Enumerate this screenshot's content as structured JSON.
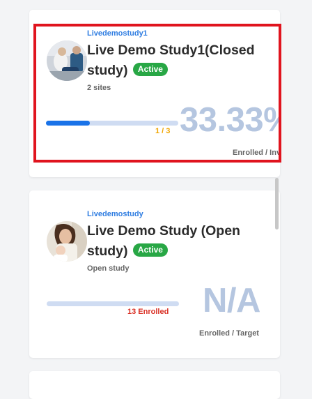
{
  "studies": [
    {
      "code": "Livedemostudy1",
      "title": "Live Demo Study1(Closed study)",
      "title_line1": "Live Demo Study1(Closed",
      "title_line2": "study)",
      "status": "Active",
      "subtitle": "2 sites",
      "enrolled_count": "1 / 3",
      "progress_fraction": 0.333,
      "percent": "33.33%",
      "caption": "Enrolled / Invited"
    },
    {
      "code": "Livedemostudy",
      "title": "Live Demo Study (Open study)",
      "title_line1": "Live Demo Study (Open",
      "title_line2": "study)",
      "status": "Active",
      "subtitle": "Open study",
      "enrolled_count": "13 Enrolled",
      "progress_fraction": 0,
      "percent": "N/A",
      "caption": "Enrolled / Target"
    }
  ],
  "colors": {
    "accent": "#1a73e8",
    "code_text": "#2f7de1",
    "active_badge": "#28a745",
    "count_warning": "#f0a500",
    "count_danger": "#d93025",
    "highlight_border": "#e0141e",
    "percent_text": "#b5c6e0"
  }
}
